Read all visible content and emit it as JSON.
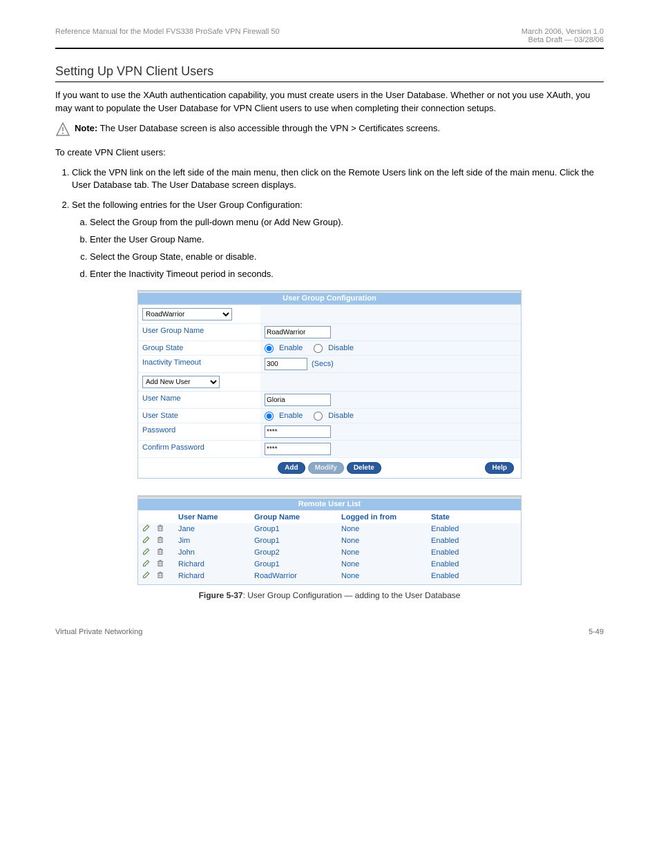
{
  "header": {
    "left": "Reference Manual for the Model FVS338 ProSafe VPN Firewall 50",
    "right_line1": "March 2006, Version 1.0",
    "right_line2": "Beta Draft — 03/28/06"
  },
  "section_title": "Setting Up VPN Client Users",
  "intro": "If you want to use the XAuth authentication capability, you must create users in the User Database. Whether or not you use XAuth, you may want to populate the User Database for VPN Client users to use when completing their connection setups.",
  "note_label": "Note:",
  "note_text": "The User Database screen is also accessible through the VPN > Certificates screens.",
  "steps_intro": "To create VPN Client users:",
  "steps": [
    "Click the VPN link on the left side of the main menu, then click on the Remote Users link on the left side of the main menu. Click the User Database tab. The User Database screen displays.",
    "Set the following entries for the User Group Configuration:"
  ],
  "substeps": [
    "Select the Group from the pull-down menu (or Add New Group).",
    "Enter the User Group Name.",
    "Select the Group State, enable or disable.",
    "Enter the Inactivity Timeout period in seconds."
  ],
  "panel1": {
    "title": "User Group Configuration",
    "group_select": "RoadWarrior",
    "labels": {
      "group_name": "User Group Name",
      "group_state": "Group State",
      "inactivity": "Inactivity Timeout",
      "add_user_select": "Add New User",
      "user_name": "User Name",
      "user_state": "User State",
      "password": "Password",
      "confirm": "Confirm Password"
    },
    "values": {
      "group_name": "RoadWarrior",
      "inactivity": "300",
      "inactivity_suffix": "(Secs)",
      "user_name": "Gloria",
      "password": "****",
      "confirm": "****"
    },
    "radio": {
      "enable": "Enable",
      "disable": "Disable"
    },
    "buttons": {
      "add": "Add",
      "modify": "Modify",
      "delete": "Delete",
      "help": "Help"
    }
  },
  "panel2": {
    "title": "Remote User List",
    "headers": {
      "user": "User Name",
      "group": "Group Name",
      "logged": "Logged in from",
      "state": "State"
    },
    "rows": [
      {
        "user": "Jane",
        "group": "Group1",
        "logged": "None",
        "state": "Enabled"
      },
      {
        "user": "Jim",
        "group": "Group1",
        "logged": "None",
        "state": "Enabled"
      },
      {
        "user": "John",
        "group": "Group2",
        "logged": "None",
        "state": "Enabled"
      },
      {
        "user": "Richard",
        "group": "Group1",
        "logged": "None",
        "state": "Enabled"
      },
      {
        "user": "Richard",
        "group": "RoadWarrior",
        "logged": "None",
        "state": "Enabled"
      }
    ]
  },
  "figure_num": "Figure 5-37",
  "figure_caption": ": User Group Configuration — adding to the User Database",
  "footer": {
    "left": "Virtual Private Networking",
    "right": "5-49"
  }
}
